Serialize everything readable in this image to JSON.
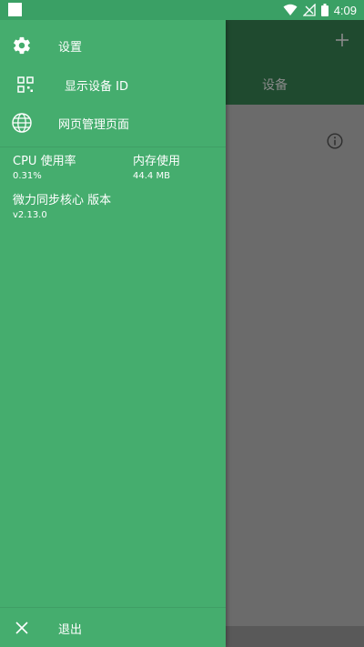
{
  "status_bar": {
    "time": "4:09",
    "icons": [
      "notification-square-icon",
      "wifi-icon",
      "no-signal-icon",
      "battery-icon"
    ]
  },
  "app": {
    "toolbar": {
      "action_icon": "plus-icon"
    },
    "tabs": [
      {
        "label": "设备"
      }
    ],
    "info_icon": "info-icon"
  },
  "drawer": {
    "menu": [
      {
        "icon": "gear-icon",
        "label": "设置"
      },
      {
        "icon": "qr-code-icon",
        "label": "显示设备 ID"
      },
      {
        "icon": "globe-icon",
        "label": "网页管理页面"
      }
    ],
    "stats": {
      "cpu": {
        "label": "CPU 使用率",
        "value": "0.31%"
      },
      "memory": {
        "label": "内存使用",
        "value": "44.4 MB"
      },
      "version": {
        "label": "微力同步核心 版本",
        "value": "v2.13.0"
      }
    },
    "exit": {
      "icon": "close-icon",
      "label": "退出"
    }
  },
  "colors": {
    "drawer_bg": "#45ad6e",
    "status_bar": "#3aa065",
    "toolbar_dimmed": "#1f4a2f",
    "scrim": "#6b6b6b"
  }
}
